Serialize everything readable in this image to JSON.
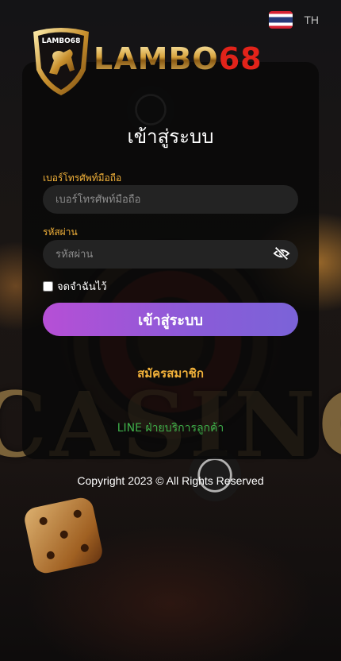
{
  "header": {
    "language_label": "TH",
    "brand_logo_text": "LAMBO68",
    "brand_wordmark_main": "LAMBO",
    "brand_wordmark_number": "68"
  },
  "login_form": {
    "title": "เข้าสู่ระบบ",
    "phone_label": "เบอร์โทรศัพท์มือถือ",
    "phone_placeholder": "เบอร์โทรศัพท์มือถือ",
    "phone_value": "",
    "password_label": "รหัสผ่าน",
    "password_placeholder": "รหัสผ่าน",
    "password_value": "",
    "remember_label": "จดจำฉันไว้",
    "remember_checked": false,
    "submit_label": "เข้าสู่ระบบ",
    "register_label": "สมัครสมาชิก",
    "support_link_label": "LINE ฝ่ายบริการลูกค้า"
  },
  "footer": {
    "copyright": "Copyright 2023 © All Rights Reserved"
  },
  "colors": {
    "accent_gold": "#f3b23a",
    "button_gradient_start": "#b64fd6",
    "button_gradient_end": "#7b63d8",
    "line_green": "#3fb14a",
    "brand_red": "#e2231a"
  },
  "icons": {
    "flag": "thailand-flag-icon",
    "password_toggle": "eye-slash-icon",
    "logo": "bull-shield-logo"
  }
}
